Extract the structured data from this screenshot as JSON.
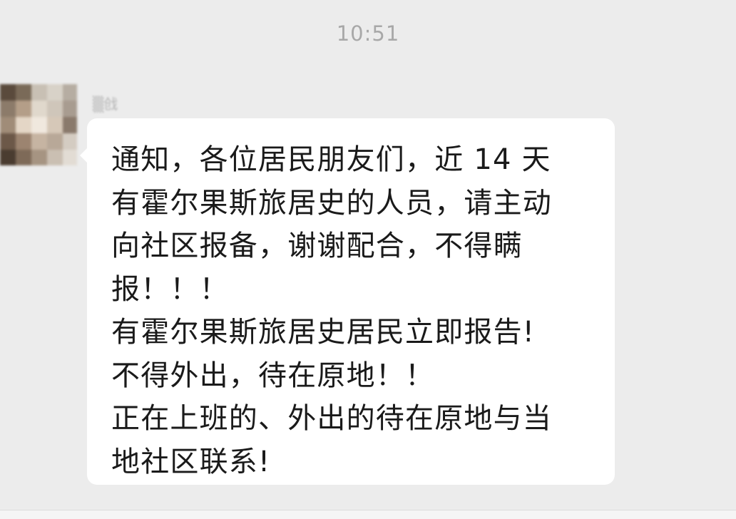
{
  "chat": {
    "timestamp": "10:51",
    "message": {
      "sender_name": "▒戗",
      "lines": [
        "通知，各位居民朋友们，近 14 天",
        "有霍尔果斯旅居史的人员，请主动",
        "向社区报备，谢谢配合，不得瞒",
        "报！！！",
        "有霍尔果斯旅居史居民立即报告!",
        "不得外出，待在原地！！",
        "正在上班的、外出的待在原地与当",
        "地社区联系!"
      ]
    }
  },
  "colors": {
    "background": "#ececec",
    "bubble": "#ffffff",
    "text": "#1a1a1a",
    "timestamp": "#a8a8a8"
  }
}
